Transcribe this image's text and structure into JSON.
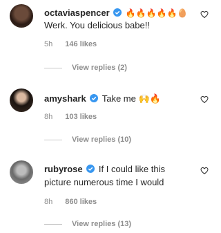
{
  "comments": [
    {
      "username": "octaviaspencer",
      "text_line1": "",
      "text_line2": "Werk. You delicious babe!!",
      "emojis": "🔥🔥🔥🔥🔥🥚",
      "time": "5h",
      "likes": "146 likes",
      "replies": "View replies (2)"
    },
    {
      "username": "amyshark",
      "text_line1": "Take me 🙌🔥",
      "text_line2": "",
      "time": "8h",
      "likes": "103 likes",
      "replies": "View replies (10)"
    },
    {
      "username": "rubyrose",
      "text_line1": "If I could like this",
      "text_line2": "picture numerous time I would",
      "time": "8h",
      "likes": "860 likes",
      "replies": "View replies (13)"
    }
  ],
  "colors": {
    "verified": "#3897f0",
    "meta": "#8e8e8e",
    "text": "#262626"
  }
}
